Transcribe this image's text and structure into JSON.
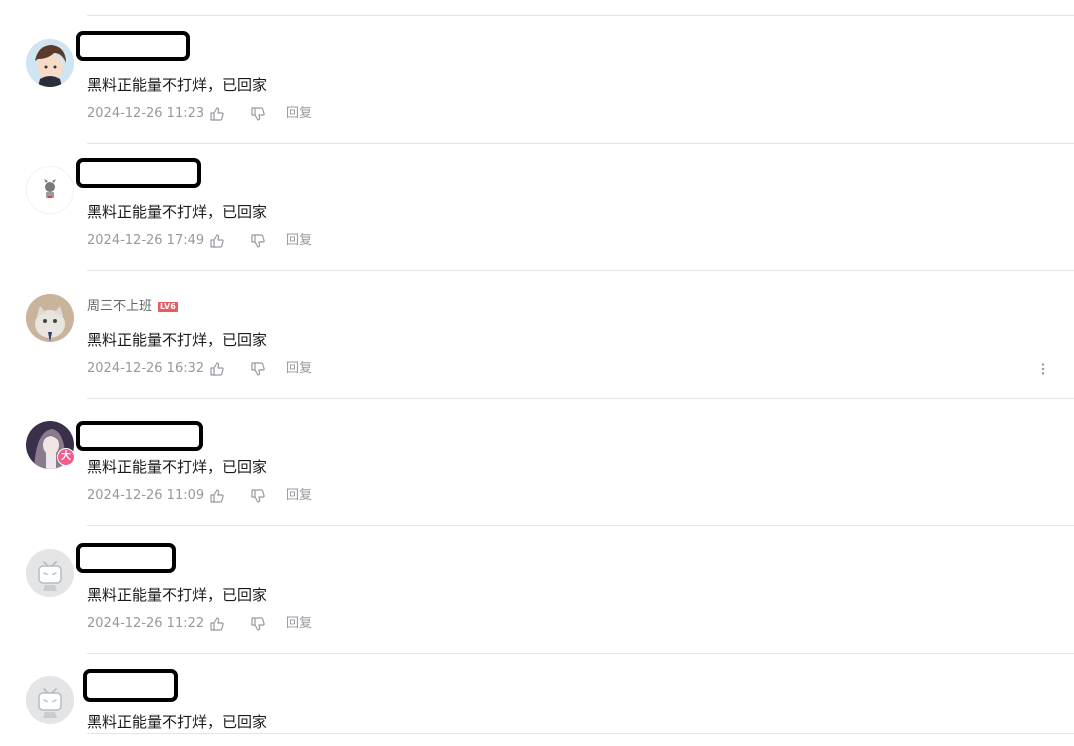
{
  "comments": [
    {
      "username": "",
      "username_redacted": true,
      "content": "黑料正能量不打烊，已回家",
      "time": "2024-12-26 11:23",
      "reply_label": "回复",
      "avatar": "anime-boy-avatar"
    },
    {
      "username": "",
      "username_redacted": true,
      "content": "黑料正能量不打烊，已回家",
      "time": "2024-12-26 17:49",
      "reply_label": "回复",
      "avatar": "small-figure-avatar"
    },
    {
      "username": "周三不上班",
      "username_redacted": false,
      "level": "LV6",
      "content": "黑料正能量不打烊，已回家",
      "time": "2024-12-26 16:32",
      "reply_label": "回复",
      "avatar": "cat-avatar",
      "show_more_menu": true
    },
    {
      "username": "",
      "username_redacted": true,
      "content": "黑料正能量不打烊，已回家",
      "time": "2024-12-26 11:09",
      "reply_label": "回复",
      "avatar": "anime-girl-avatar",
      "vip_badge": "大"
    },
    {
      "username": "",
      "username_redacted": true,
      "content": "黑料正能量不打烊，已回家",
      "time": "2024-12-26 11:22",
      "reply_label": "回复",
      "avatar": "default-tv-avatar"
    },
    {
      "username": "",
      "username_redacted": true,
      "content": "黑料正能量不打烊，已回家",
      "avatar": "default-tv-avatar"
    }
  ],
  "colors": {
    "text_primary": "#18191c",
    "text_meta": "#9499a0",
    "username": "#61666d",
    "divider": "#e3e5e7",
    "level_badge": "#e85a61",
    "vip_badge": "#f25d8e"
  }
}
